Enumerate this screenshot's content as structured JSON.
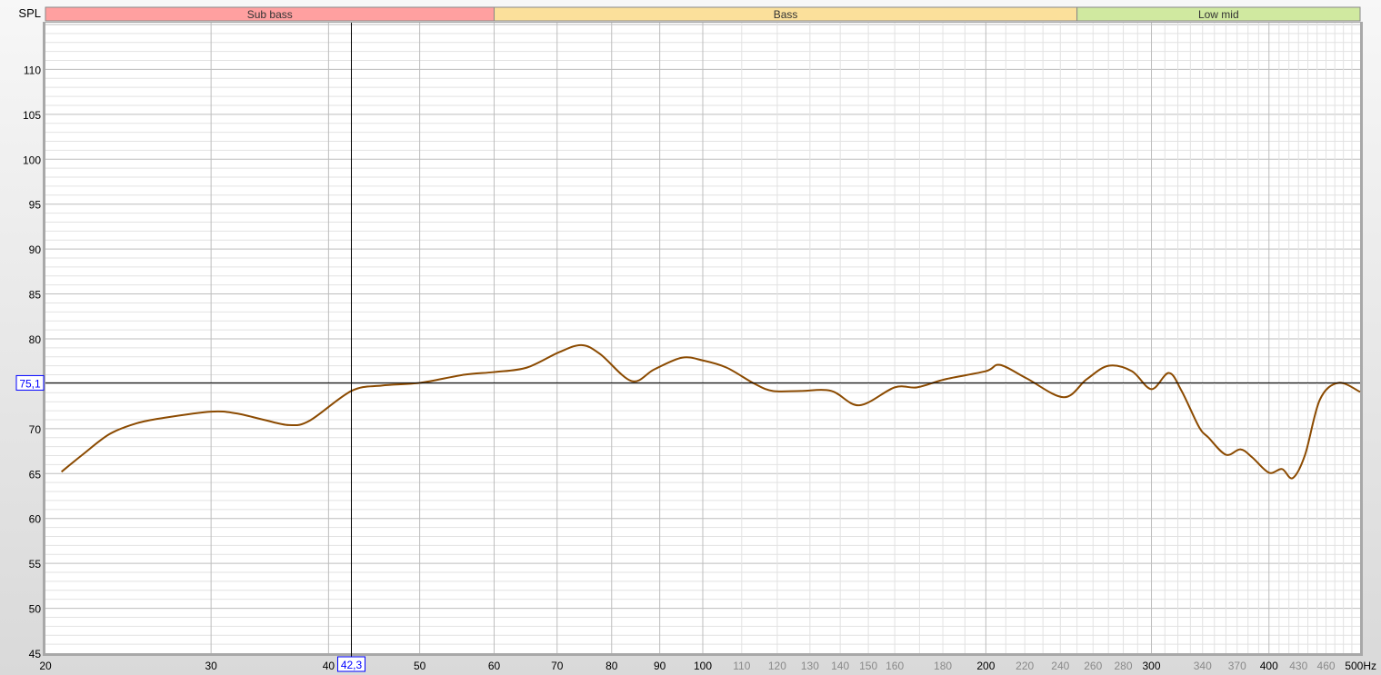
{
  "chart_data": {
    "type": "line",
    "ylabel": "SPL",
    "x_unit": "Hz",
    "xscale": "log",
    "xlim": [
      20,
      500
    ],
    "ylim": [
      45,
      115.2
    ],
    "grid": true,
    "bands": [
      {
        "label": "Sub bass",
        "from": 20,
        "to": 60,
        "color": "#ffa0a0"
      },
      {
        "label": "Bass",
        "from": 60,
        "to": 250,
        "color": "#fbe09b"
      },
      {
        "label": "Low mid",
        "from": 250,
        "to": 500,
        "color": "#d0e9a0"
      }
    ],
    "y_ticks": [
      45,
      50,
      55,
      60,
      65,
      70,
      75,
      80,
      85,
      90,
      95,
      100,
      105,
      110
    ],
    "x_ticks_major": [
      "20",
      "30",
      "40",
      "50",
      "60",
      "70",
      "80",
      "90",
      "100",
      "200",
      "300",
      "400",
      "500Hz"
    ],
    "x_ticks_major_values": [
      20,
      30,
      40,
      50,
      60,
      70,
      80,
      90,
      100,
      200,
      300,
      400,
      500
    ],
    "x_ticks_minor": [
      "110",
      "120",
      "130",
      "140",
      "150",
      "160",
      "180",
      "220",
      "240",
      "260",
      "280",
      "340",
      "370",
      "430",
      "460"
    ],
    "cursor": {
      "x": 42.3,
      "y": 75.1,
      "x_label": "42,3",
      "y_label": "75,1"
    },
    "series": [
      {
        "name": "SPL",
        "color": "#8b4a00",
        "x": [
          20.8,
          21.9,
          23.4,
          25.0,
          26.7,
          30,
          31.9,
          34.1,
          36.3,
          38.2,
          42.3,
          45.6,
          50,
          55.7,
          60,
          65,
          70.3,
          74.3,
          77.8,
          84,
          88.8,
          95,
          100,
          106,
          113.5,
          118.7,
          127,
          137,
          146.7,
          160,
          169,
          181,
          200,
          207,
          221,
          242,
          256,
          270,
          286,
          300,
          313,
          323,
          337,
          345,
          360,
          373,
          384,
          400,
          413,
          424,
          437,
          453,
          474,
          500
        ],
        "y": [
          65.2,
          67.1,
          69.4,
          70.6,
          71.2,
          71.9,
          71.7,
          71.0,
          70.4,
          70.9,
          74.2,
          74.8,
          75.1,
          76.0,
          76.3,
          76.8,
          78.5,
          79.3,
          78.3,
          75.3,
          76.6,
          77.9,
          77.6,
          76.8,
          75.0,
          74.2,
          74.2,
          74.2,
          72.6,
          74.6,
          74.6,
          75.5,
          76.4,
          77.1,
          75.6,
          73.5,
          75.5,
          77.0,
          76.4,
          74.4,
          76.2,
          74.2,
          70.2,
          69.0,
          67.1,
          67.7,
          66.8,
          65.1,
          65.5,
          64.5,
          67.1,
          73.2,
          75.1,
          74.1
        ]
      }
    ]
  }
}
